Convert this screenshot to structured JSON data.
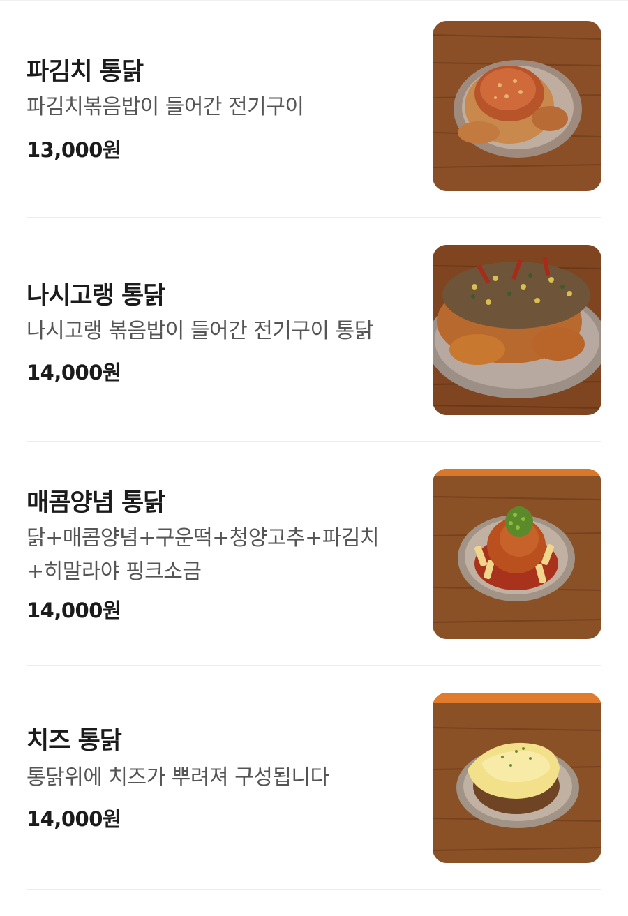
{
  "menu": {
    "items": [
      {
        "name": "파김치 통닭",
        "description": "파김치볶음밥이 들어간 전기구이",
        "price": "13,000원",
        "image": "pakimchi-chicken-photo"
      },
      {
        "name": "나시고랭 통닭",
        "description": "나시고랭 볶음밥이 들어간 전기구이 통닭",
        "price": "14,000원",
        "image": "nasi-goreng-chicken-photo"
      },
      {
        "name": "매콤양념 통닭",
        "description": "닭+매콤양념+구운떡+청양고추+파김치+히말라야 핑크소금",
        "description_line1": "닭+매콤양념+구운떡+청양고추+파김치",
        "description_line2": "+히말라야 핑크소금",
        "price": "14,000원",
        "image": "spicy-seasoned-chicken-photo"
      },
      {
        "name": "치즈 통닭",
        "description": "통닭위에 치즈가 뿌려져 구성됩니다",
        "price": "14,000원",
        "image": "cheese-chicken-photo"
      }
    ]
  },
  "colors": {
    "wood": "#8a4f26",
    "wood_dark": "#6a3818",
    "plate": "#b8a79a",
    "chicken": "#c06a2c",
    "divider": "#ececec"
  }
}
